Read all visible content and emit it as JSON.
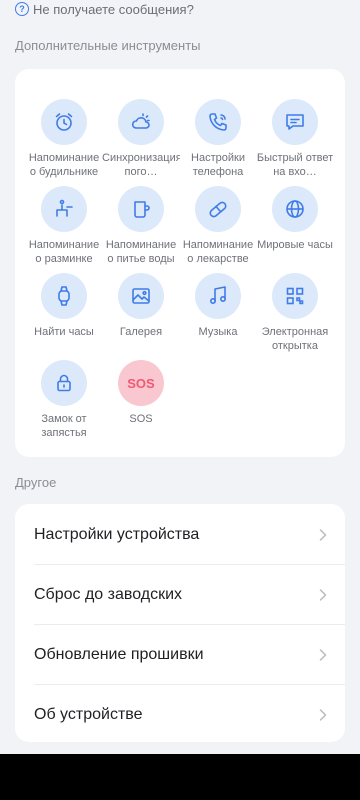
{
  "help": {
    "icon": "question-circle-icon",
    "text": "Не получаете сообщения?"
  },
  "tools_section": {
    "title": "Дополнительные инструменты",
    "items": [
      {
        "label": "Напоминание о будильнике",
        "icon": "alarm-clock-icon"
      },
      {
        "label": "Синхронизация пого…",
        "icon": "weather-sun-cloud-icon"
      },
      {
        "label": "Настройки телефона",
        "icon": "phone-icon"
      },
      {
        "label": "Быстрый ответ на вхо…",
        "icon": "message-icon"
      },
      {
        "label": "Напоминание о разминке",
        "icon": "sitting-person-icon"
      },
      {
        "label": "Напоминание о питье воды",
        "icon": "cup-icon"
      },
      {
        "label": "Напоминание о лекарстве",
        "icon": "pill-icon"
      },
      {
        "label": "Мировые часы",
        "icon": "globe-icon"
      },
      {
        "label": "Найти часы",
        "icon": "watch-icon"
      },
      {
        "label": "Галерея",
        "icon": "image-icon"
      },
      {
        "label": "Музыка",
        "icon": "music-note-icon"
      },
      {
        "label": "Электронная открытка",
        "icon": "qr-code-icon"
      },
      {
        "label": "Замок от запястья",
        "icon": "lock-icon"
      },
      {
        "label": "SOS",
        "icon_text": "SOS"
      }
    ]
  },
  "other_section": {
    "title": "Другое",
    "items": [
      {
        "label": "Настройки устройства"
      },
      {
        "label": "Сброс до заводских"
      },
      {
        "label": "Обновление прошивки"
      },
      {
        "label": "Об устройстве"
      }
    ]
  },
  "colors": {
    "accent": "#3f7ce8",
    "icon_bg": "#dce9fb",
    "sos": "#f15873",
    "sos_bg": "#f9c7cf"
  }
}
